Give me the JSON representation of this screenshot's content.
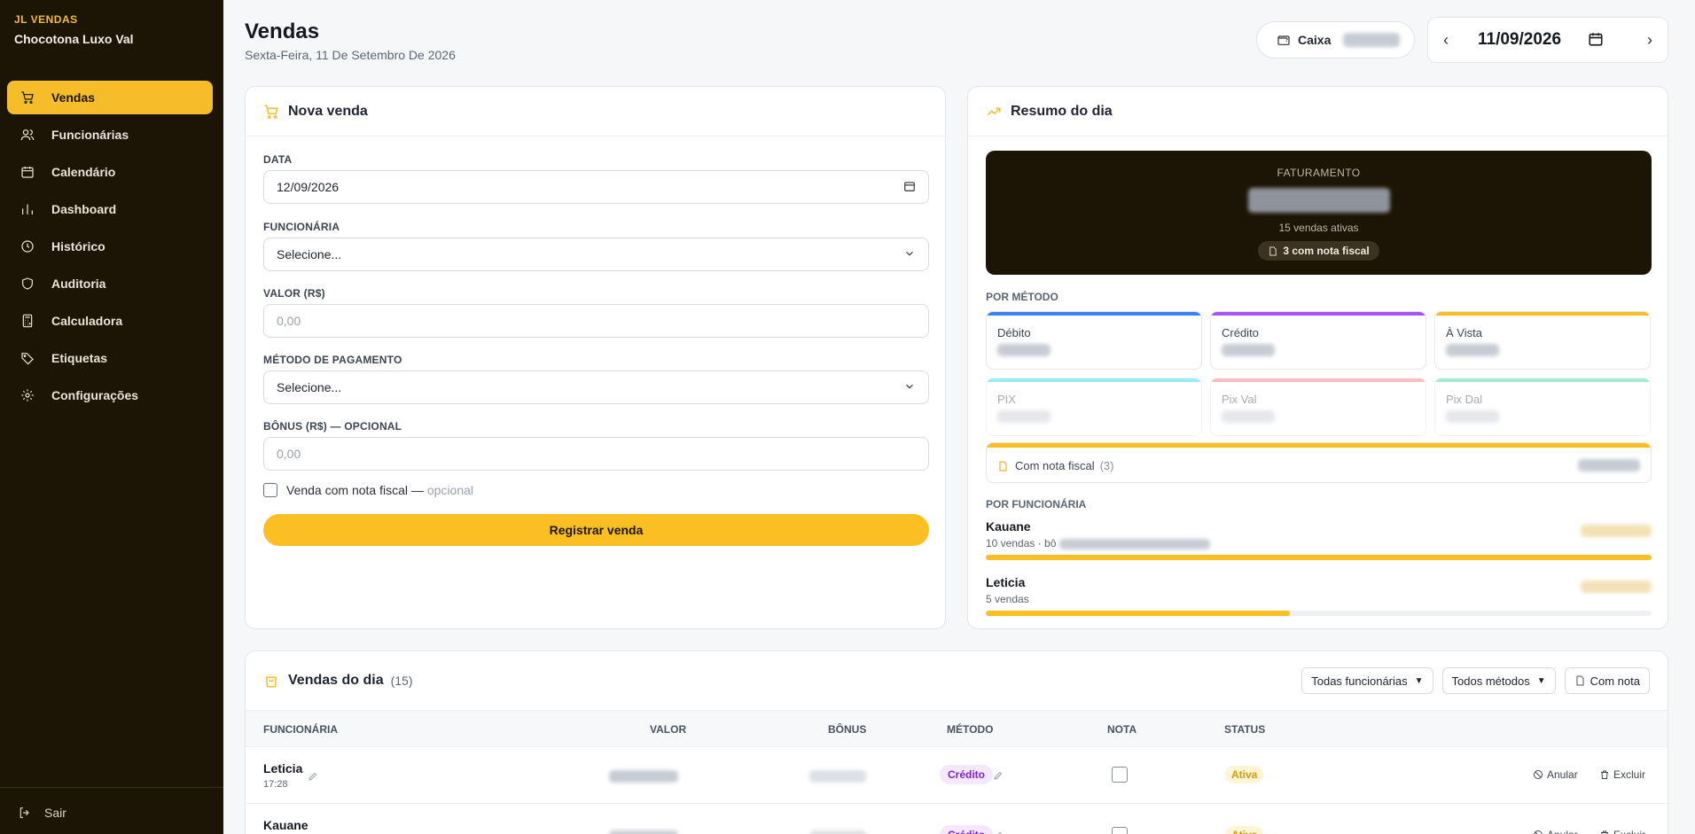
{
  "app": {
    "brand_small": "JL VENDAS",
    "brand_name": "Chocotona Luxo Val"
  },
  "sidebar": {
    "items": [
      {
        "label": "Vendas",
        "icon": "cart-icon",
        "active": true
      },
      {
        "label": "Funcionárias",
        "icon": "users-icon"
      },
      {
        "label": "Calendário",
        "icon": "calendar-icon"
      },
      {
        "label": "Dashboard",
        "icon": "bar-chart-icon"
      },
      {
        "label": "Histórico",
        "icon": "clock-icon"
      },
      {
        "label": "Auditoria",
        "icon": "shield-icon"
      },
      {
        "label": "Calculadora",
        "icon": "calculator-icon"
      },
      {
        "label": "Etiquetas",
        "icon": "tag-icon"
      },
      {
        "label": "Configurações",
        "icon": "gear-icon"
      }
    ],
    "logout": "Sair"
  },
  "header": {
    "title": "Vendas",
    "subtitle": "Sexta-Feira, 11 De Setembro De 2026",
    "caixa_label": "Caixa",
    "date": "11/09/2026"
  },
  "nova_venda": {
    "title": "Nova venda",
    "date_label": "DATA",
    "date_value": "12/09/2026",
    "funcionaria_label": "FUNCIONÁRIA",
    "funcionaria_value": "Selecione...",
    "valor_label": "VALOR (R$)",
    "valor_placeholder": "0,00",
    "metodo_label": "MÉTODO DE PAGAMENTO",
    "metodo_value": "Selecione...",
    "bonus_label": "BÔNUS (R$) — OPCIONAL",
    "bonus_placeholder": "0,00",
    "nota_check_label": "Venda com nota fiscal —",
    "nota_check_optional": "opcional",
    "submit": "Registrar venda"
  },
  "resumo": {
    "title": "Resumo do dia",
    "faturamento_label": "FATURAMENTO",
    "vendas_ativas": "15 vendas ativas",
    "com_nota_badge": "3 com nota fiscal",
    "por_metodo_label": "POR MÉTODO",
    "metodos": [
      {
        "name": "Débito",
        "color": "#3b82f6"
      },
      {
        "name": "Crédito",
        "color": "#a855f7"
      },
      {
        "name": "À Vista",
        "color": "#fbbf24"
      },
      {
        "name": "PIX",
        "color": "#22d3ee"
      },
      {
        "name": "Pix Val",
        "color": "#f87171"
      },
      {
        "name": "Pix Dal",
        "color": "#34d399"
      }
    ],
    "com_nota_label": "Com nota fiscal",
    "com_nota_count": "(3)",
    "por_funcionaria_label": "POR FUNCIONÁRIA",
    "funcionarias": [
      {
        "name": "Kauane",
        "sub": "10 vendas · bô",
        "share": 1.0
      },
      {
        "name": "Leticia",
        "sub": "5 vendas",
        "share": 0.457
      }
    ]
  },
  "vendas_dia": {
    "title": "Vendas do dia",
    "count": "(15)",
    "filter_funcionarias": "Todas funcionárias",
    "filter_metodos": "Todos métodos",
    "filter_nota": "Com nota",
    "columns": [
      "FUNCIONÁRIA",
      "VALOR",
      "BÔNUS",
      "MÉTODO",
      "NOTA",
      "STATUS"
    ],
    "rows": [
      {
        "funcionaria": "Leticia",
        "time": "17:28",
        "metodo": "Crédito",
        "status": "Ativa"
      },
      {
        "funcionaria": "Kauane",
        "time": "",
        "metodo": "Crédito",
        "status": "Ativa"
      }
    ],
    "action_anular": "Anular",
    "action_excluir": "Excluir"
  },
  "colors": {
    "accent": "#fbbf24",
    "sidebar_bg": "#1c1405"
  }
}
